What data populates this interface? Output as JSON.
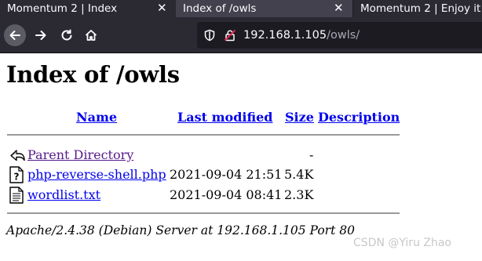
{
  "tabs": [
    {
      "title": "Momentum 2 | Index",
      "active": false
    },
    {
      "title": "Index of /owls",
      "active": true
    },
    {
      "title": "Momentum 2 | Enjoy it",
      "active": false
    }
  ],
  "tab_close_glyph": "✕",
  "address_bar": {
    "host": "192.168.1.105",
    "path": "/owls/"
  },
  "page": {
    "heading": "Index of /owls",
    "columns": [
      "Name",
      "Last modified",
      "Size",
      "Description"
    ],
    "rows": [
      {
        "name": "Parent Directory",
        "modified": "",
        "size": "-",
        "icon": "back-arrow-icon"
      },
      {
        "name": "php-reverse-shell.php",
        "modified": "2021-09-04 21:51",
        "size": "5.4K",
        "icon": "unknown-file-icon"
      },
      {
        "name": "wordlist.txt",
        "modified": "2021-09-04 08:41",
        "size": "2.3K",
        "icon": "text-file-icon"
      }
    ],
    "footer": "Apache/2.4.38 (Debian) Server at 192.168.1.105 Port 80"
  },
  "watermark": "CSDN @Yiru Zhao",
  "colors": {
    "link": "#0000ee",
    "visited_link": "#551a8b",
    "chrome_dark": "#1c1b22",
    "chrome": "#2b2a33",
    "active_tab": "#42414d"
  }
}
